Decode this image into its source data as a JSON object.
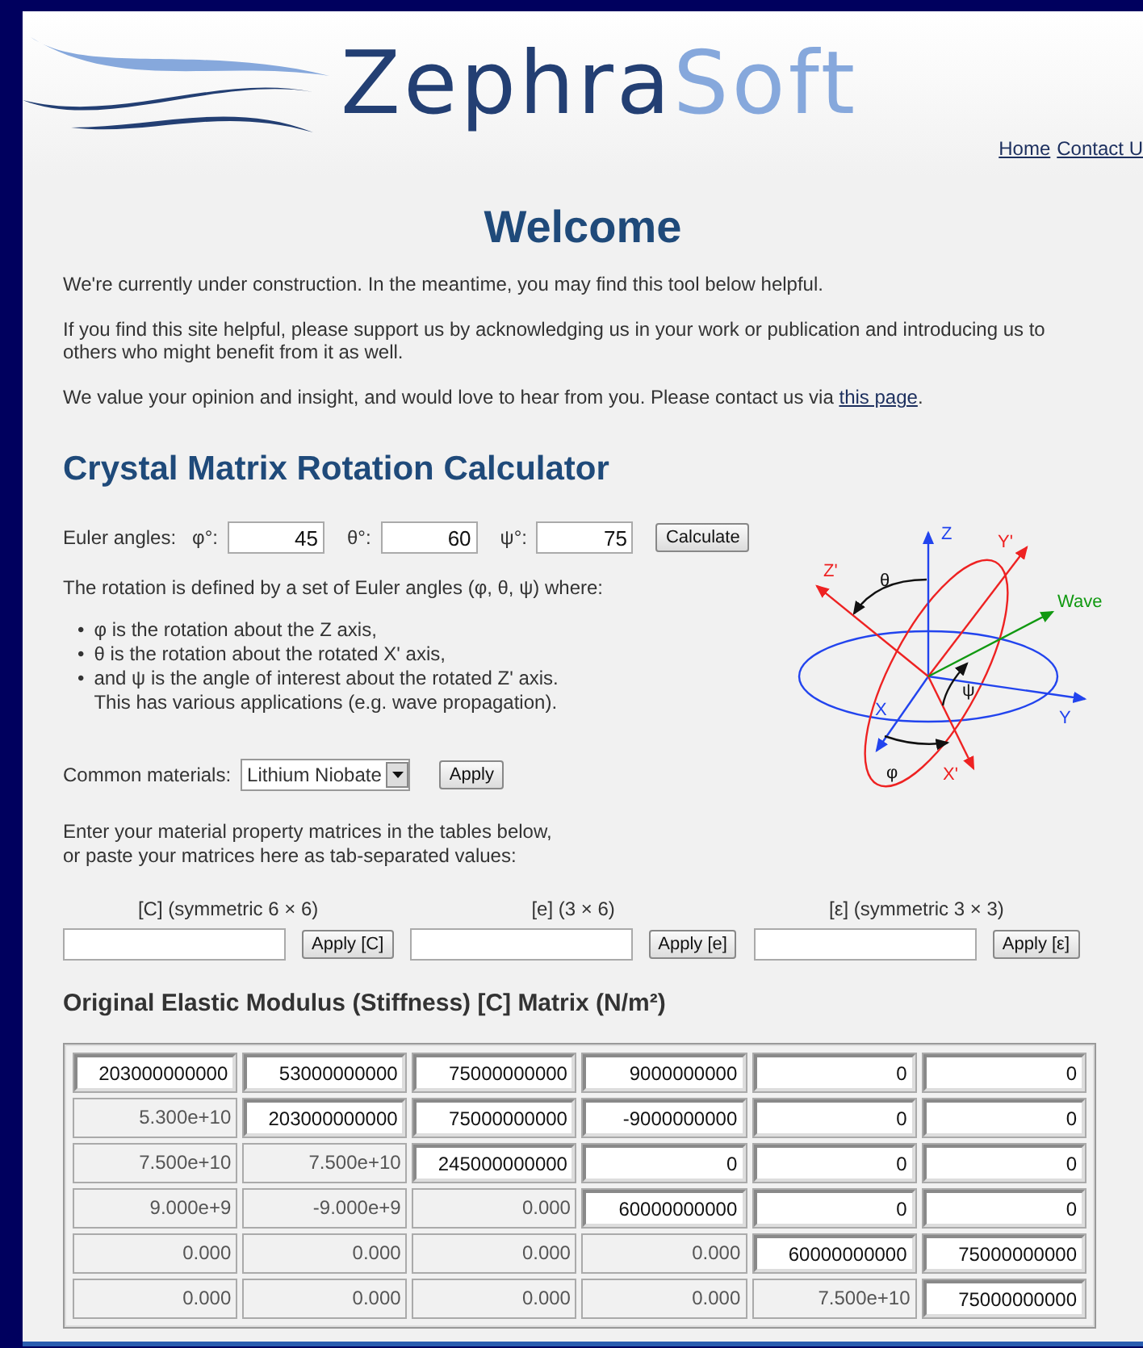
{
  "header": {
    "logo": {
      "part_1": "Zephra",
      "part_2": "Soft"
    },
    "nav": [
      "Home",
      "Contact U"
    ]
  },
  "heading": "Welcome",
  "paragraphs": [
    {
      "text": "We're currently under construction. In the meantime, you may find this tool below helpful."
    },
    {
      "text": "If you find this site helpful, please support us by acknowledging us in your work or publication and introducing us to others who might benefit from it as well."
    },
    {
      "text": "We value your opinion and insight, and would love to hear from you. Please contact us via ",
      "link": "this page",
      "tail": "."
    }
  ],
  "calculator": {
    "title": "Crystal Matrix Rotation Calculator",
    "euler_label": "Euler angles:",
    "angles": [
      {
        "label": "φ°:",
        "value": "45"
      },
      {
        "label": "θ°:",
        "value": "60"
      },
      {
        "label": "ψ°:",
        "value": "75"
      }
    ],
    "calculate": "Calculate",
    "description": "The rotation is defined by a set of Euler angles (φ, θ, ψ) where:",
    "bullets": [
      {
        "marker": "•",
        "lines": [
          "φ is the rotation about the Z axis,"
        ]
      },
      {
        "marker": "•",
        "lines": [
          "θ is the rotation about the rotated X' axis,"
        ]
      },
      {
        "marker": "•",
        "lines": [
          "and ψ is the angle of interest about the rotated Z' axis.",
          "This has various applications (e.g. wave propagation)."
        ]
      }
    ],
    "diagram_labels": [
      "Z",
      "Y'",
      "Z'",
      "θ",
      "Wave",
      "ψ",
      "X",
      "Y",
      "φ",
      "X'"
    ],
    "materials": {
      "label": "Common materials:",
      "value": "Lithium Niobate",
      "apply": "Apply"
    },
    "paste_intro": [
      "Enter your material property matrices in the tables below,",
      "or paste your matrices here as tab-separated values:"
    ],
    "paste_fields": [
      {
        "label": "[C] (symmetric 6 × 6)",
        "button": "Apply [C]"
      },
      {
        "label": "[e] (3 × 6)",
        "button": "Apply [e]"
      },
      {
        "label": "[ε] (symmetric 3 × 3)",
        "button": "Apply [ε]"
      }
    ]
  },
  "matrix": {
    "title": "Original Elastic Modulus (Stiffness) [C] Matrix (N/m²)",
    "rows": [
      [
        {
          "kind": "input",
          "value": "203000000000"
        },
        {
          "kind": "input",
          "value": "53000000000"
        },
        {
          "kind": "input",
          "value": "75000000000"
        },
        {
          "kind": "input",
          "value": "9000000000"
        },
        {
          "kind": "input",
          "value": "0"
        },
        {
          "kind": "input",
          "value": "0"
        }
      ],
      [
        {
          "kind": "computed",
          "value": "5.300e+10"
        },
        {
          "kind": "input",
          "value": "203000000000"
        },
        {
          "kind": "input",
          "value": "75000000000"
        },
        {
          "kind": "input",
          "value": "-9000000000"
        },
        {
          "kind": "input",
          "value": "0"
        },
        {
          "kind": "input",
          "value": "0"
        }
      ],
      [
        {
          "kind": "computed",
          "value": "7.500e+10"
        },
        {
          "kind": "computed",
          "value": "7.500e+10"
        },
        {
          "kind": "input",
          "value": "245000000000"
        },
        {
          "kind": "input",
          "value": "0"
        },
        {
          "kind": "input",
          "value": "0"
        },
        {
          "kind": "input",
          "value": "0"
        }
      ],
      [
        {
          "kind": "computed",
          "value": "9.000e+9"
        },
        {
          "kind": "computed",
          "value": "-9.000e+9"
        },
        {
          "kind": "computed",
          "value": "0.000"
        },
        {
          "kind": "input",
          "value": "60000000000"
        },
        {
          "kind": "input",
          "value": "0"
        },
        {
          "kind": "input",
          "value": "0"
        }
      ],
      [
        {
          "kind": "computed",
          "value": "0.000"
        },
        {
          "kind": "computed",
          "value": "0.000"
        },
        {
          "kind": "computed",
          "value": "0.000"
        },
        {
          "kind": "computed",
          "value": "0.000"
        },
        {
          "kind": "input",
          "value": "60000000000"
        },
        {
          "kind": "input",
          "value": "75000000000"
        }
      ],
      [
        {
          "kind": "computed",
          "value": "0.000"
        },
        {
          "kind": "computed",
          "value": "0.000"
        },
        {
          "kind": "computed",
          "value": "0.000"
        },
        {
          "kind": "computed",
          "value": "0.000"
        },
        {
          "kind": "computed",
          "value": "7.500e+10"
        },
        {
          "kind": "input",
          "value": "75000000000"
        }
      ]
    ]
  }
}
